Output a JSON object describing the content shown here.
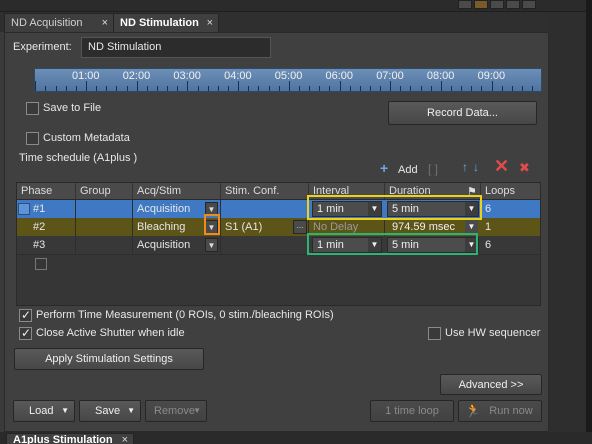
{
  "tabs": [
    {
      "label": "ND Acquisition",
      "close": "×"
    },
    {
      "label": "ND Stimulation",
      "close": "×"
    }
  ],
  "experiment": {
    "label": "Experiment:",
    "value": "ND Stimulation"
  },
  "timeline": {
    "ticks": [
      "01:00",
      "02:00",
      "03:00",
      "04:00",
      "05:00",
      "06:00",
      "07:00",
      "08:00",
      "09:00"
    ]
  },
  "save_to_file": {
    "label": "Save to File",
    "checked": false
  },
  "record_data": {
    "label": "Record Data..."
  },
  "custom_metadata": {
    "label": "Custom Metadata",
    "checked": false
  },
  "schedule": {
    "title": "Time schedule (A1plus )",
    "add_label": "Add",
    "columns": [
      "Phase",
      "Group",
      "Acq/Stim",
      "Stim. Conf.",
      "Interval",
      "Duration",
      "Loops"
    ],
    "rows": [
      {
        "phase": "#1",
        "acq_stim": "Acquisition",
        "stim_conf": "",
        "interval": "1 min",
        "duration": "5 min",
        "loops": "6"
      },
      {
        "phase": "#2",
        "acq_stim": "Bleaching",
        "stim_conf": "S1 (A1)",
        "interval": "No Delay",
        "duration": "974.59 msec",
        "loops": "1"
      },
      {
        "phase": "#3",
        "acq_stim": "Acquisition",
        "stim_conf": "",
        "interval": "1 min",
        "duration": "5 min",
        "loops": "6"
      }
    ],
    "ellipsis": "..."
  },
  "options": {
    "time_measurement": {
      "label": "Perform Time Measurement (0 ROIs, 0 stim./bleaching ROIs)",
      "checked": true
    },
    "close_shutter": {
      "label": "Close Active Shutter when idle",
      "checked": true
    },
    "hw_sequencer": {
      "label": "Use HW sequencer",
      "checked": false
    }
  },
  "buttons": {
    "apply": "Apply Stimulation Settings",
    "advanced": "Advanced >>",
    "load": "Load",
    "save": "Save",
    "remove": "Remove",
    "one_time_loop": "1 time loop",
    "run_now": "Run now"
  },
  "bottom_tab": {
    "label": "A1plus Stimulation",
    "close": "×"
  },
  "colors": {
    "selection_blue": "#3f79c4",
    "bleach_row": "#5d5418",
    "highlight_yellow": "#e7d21c",
    "highlight_green": "#2bb574",
    "highlight_orange": "#f08a1f",
    "delete_red": "#e24b4b",
    "arrow_blue": "#6fa8e6"
  }
}
